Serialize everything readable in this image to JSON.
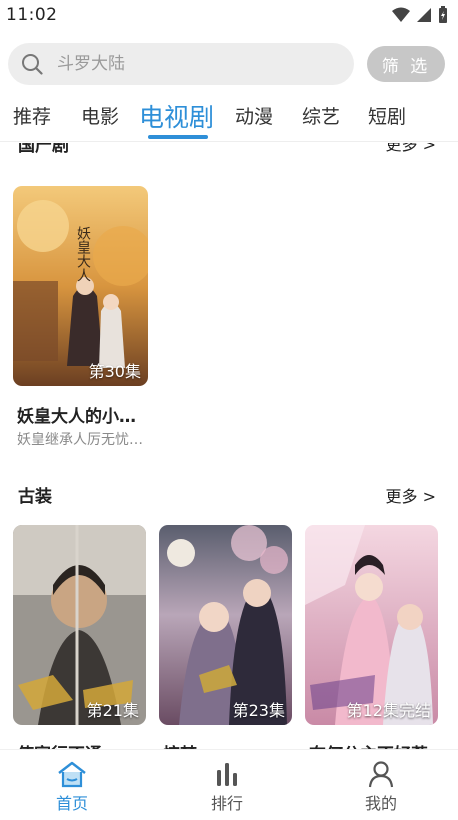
{
  "status": {
    "time": "11:02"
  },
  "search": {
    "placeholder": "斗罗大陆",
    "filter_label": "筛 选"
  },
  "tabs": [
    {
      "label": "推荐",
      "active": false
    },
    {
      "label": "电影",
      "active": false
    },
    {
      "label": "电视剧",
      "active": true
    },
    {
      "label": "动漫",
      "active": false
    },
    {
      "label": "综艺",
      "active": false
    },
    {
      "label": "短剧",
      "active": false
    }
  ],
  "sections": [
    {
      "title": "国产剧",
      "more": "更多 >",
      "items": [
        {
          "title": "妖皇大人的小…",
          "subtitle": "妖皇继承人厉无忧…",
          "episode": "第30集"
        }
      ]
    },
    {
      "title": "古装",
      "more": "更多 >",
      "items": [
        {
          "title": "使家行不通",
          "episode": "第21集"
        },
        {
          "title": "惊梦",
          "episode": "第23集"
        },
        {
          "title": "奈何公主不好惹",
          "episode": "第12集完结"
        }
      ]
    }
  ],
  "bottom_nav": [
    {
      "label": "首页",
      "active": true
    },
    {
      "label": "排行",
      "active": false
    },
    {
      "label": "我的",
      "active": false
    }
  ],
  "colors": {
    "accent": "#2e8fd8",
    "search_bg": "#ededed",
    "filter_bg": "#c7c7c7"
  }
}
